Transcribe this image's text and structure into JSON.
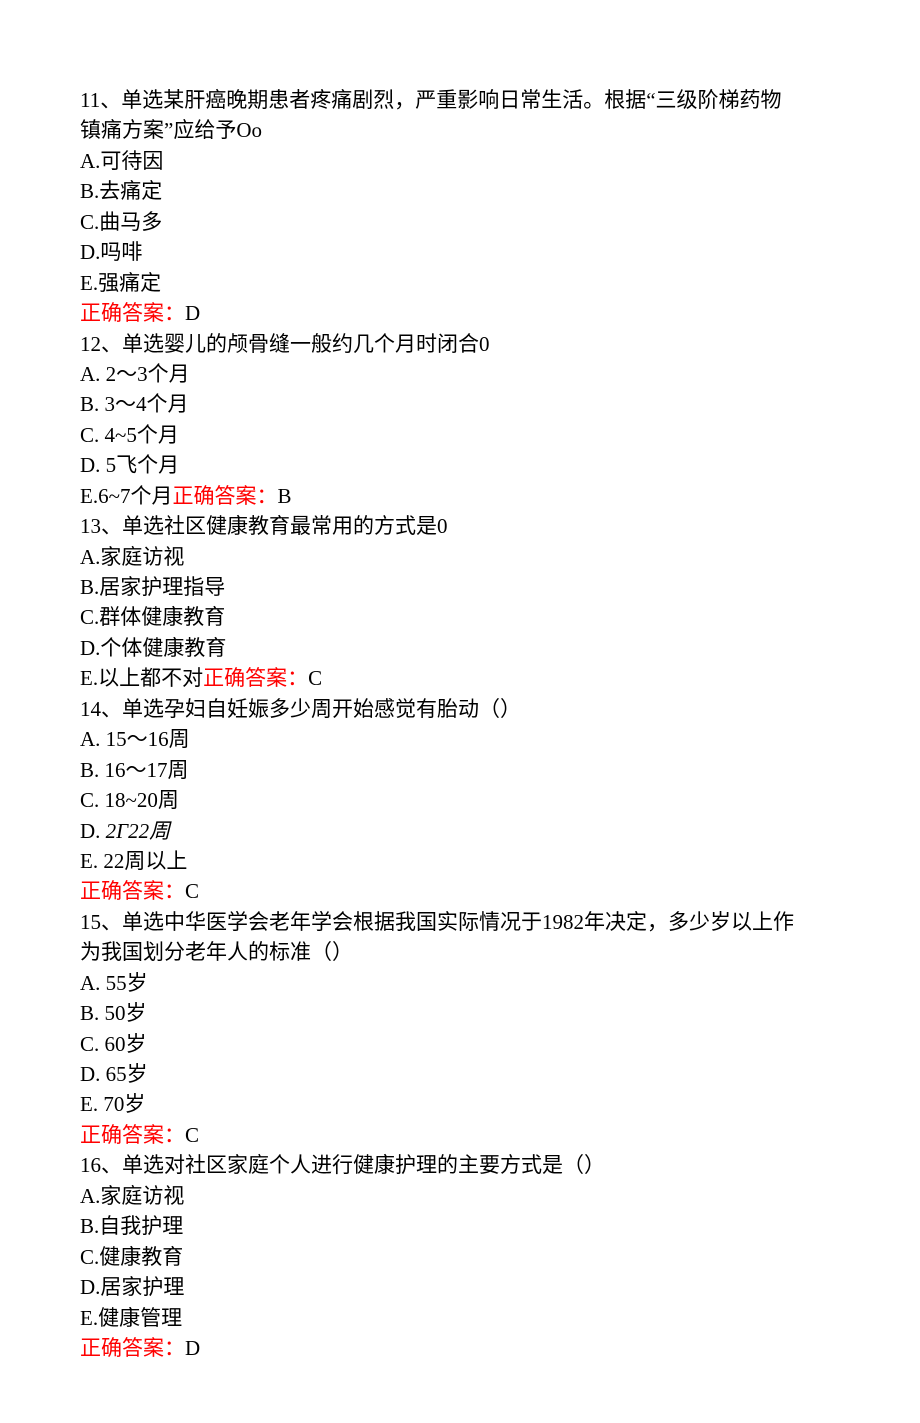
{
  "questions": [
    {
      "stem_lines": [
        "11、单选某肝癌晚期患者疼痛剧烈，严重影响日常生活。根据“三级阶梯药物",
        "镇痛方案”应给予Oo"
      ],
      "options": [
        "A.可待因",
        "B.去痛定",
        "C.曲马多",
        "D.吗啡",
        "E.强痛定"
      ],
      "answer_label": "正确答案：",
      "answer_value": "D",
      "answer_inline": false
    },
    {
      "stem_lines": [
        "12、单选婴儿的颅骨缝一般约几个月时闭合0"
      ],
      "options": [
        "A. 2～3个月",
        "B. 3～4个月",
        "C. 4~5个月",
        "D. 5飞个月"
      ],
      "last_option_prefix": "E.6~7个月",
      "answer_label": "正确答案：",
      "answer_value": "B",
      "answer_inline": true
    },
    {
      "stem_lines": [
        "13、单选社区健康教育最常用的方式是0"
      ],
      "options": [
        "A.家庭访视",
        "B.居家护理指导",
        "C.群体健康教育",
        "D.个体健康教育"
      ],
      "last_option_prefix": "E.以上都不对",
      "answer_label": "正确答案：",
      "answer_value": "C",
      "answer_inline": true
    },
    {
      "stem_lines": [
        "14、单选孕妇自妊娠多少周开始感觉有胎动（）"
      ],
      "options": [
        "A. 15～16周",
        "B. 16～17周",
        "C. 18~20周"
      ],
      "option_d_label": "D.",
      "option_d_italic": " 2Γ22周",
      "option_e": "E. 22周以上",
      "answer_label": "正确答案：",
      "answer_value": "C",
      "answer_inline": false
    },
    {
      "stem_lines": [
        "15、单选中华医学会老年学会根据我国实际情况于1982年决定，多少岁以上作",
        "为我国划分老年人的标准（）"
      ],
      "options": [
        "A. 55岁",
        "B. 50岁",
        "C. 60岁",
        "D. 65岁",
        "E. 70岁"
      ],
      "answer_label": "正确答案：",
      "answer_value": "C",
      "answer_inline": false
    },
    {
      "stem_lines": [
        "16、单选对社区家庭个人进行健康护理的主要方式是（）"
      ],
      "options": [
        "A.家庭访视",
        "B.自我护理",
        "C.健康教育",
        "D.居家护理",
        "E.健康管理"
      ],
      "answer_label": "正确答案：",
      "answer_value": "D",
      "answer_inline": false
    }
  ]
}
